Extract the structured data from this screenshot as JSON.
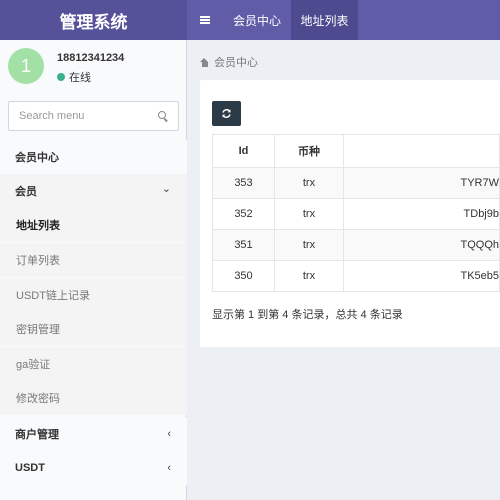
{
  "app": {
    "title": "管理系统"
  },
  "topnav": {
    "tabs": [
      {
        "label": "会员中心"
      },
      {
        "label": "地址列表"
      }
    ]
  },
  "user": {
    "avatar_text": "1",
    "name": "18812341234",
    "status": "在线"
  },
  "search": {
    "placeholder": "Search menu"
  },
  "sidebar": {
    "header": "会员中心",
    "group_member": "会员",
    "items": [
      {
        "label": "地址列表"
      },
      {
        "label": "订单列表"
      },
      {
        "label": "USDT链上记录"
      },
      {
        "label": "密钥管理"
      },
      {
        "label": "ga验证"
      },
      {
        "label": "修改密码"
      }
    ],
    "group_merchant": "商户管理",
    "group_usdt": "USDT",
    "chevron_open": "⌄",
    "chevron_closed": "‹"
  },
  "breadcrumb": {
    "label": "会员中心"
  },
  "table": {
    "headers": {
      "id": "Id",
      "coin": "币种"
    },
    "rows": [
      {
        "id": "353",
        "coin": "trx",
        "address": "TYR7W"
      },
      {
        "id": "352",
        "coin": "trx",
        "address": "TDbj9b"
      },
      {
        "id": "351",
        "coin": "trx",
        "address": "TQQQh"
      },
      {
        "id": "350",
        "coin": "trx",
        "address": "TK5eb5"
      }
    ]
  },
  "pagination": {
    "info": "显示第 1 到第 4 条记录，总共 4 条记录"
  },
  "colors": {
    "brand": "#605ca8",
    "logo_bg": "#555299",
    "active_tab": "#4e4a90",
    "online": "#3cb08c",
    "refresh_button": "#2c3b48"
  },
  "icons": {
    "menu": "bars-icon",
    "search": "search-icon",
    "home": "home-icon",
    "refresh": "refresh-icon"
  }
}
